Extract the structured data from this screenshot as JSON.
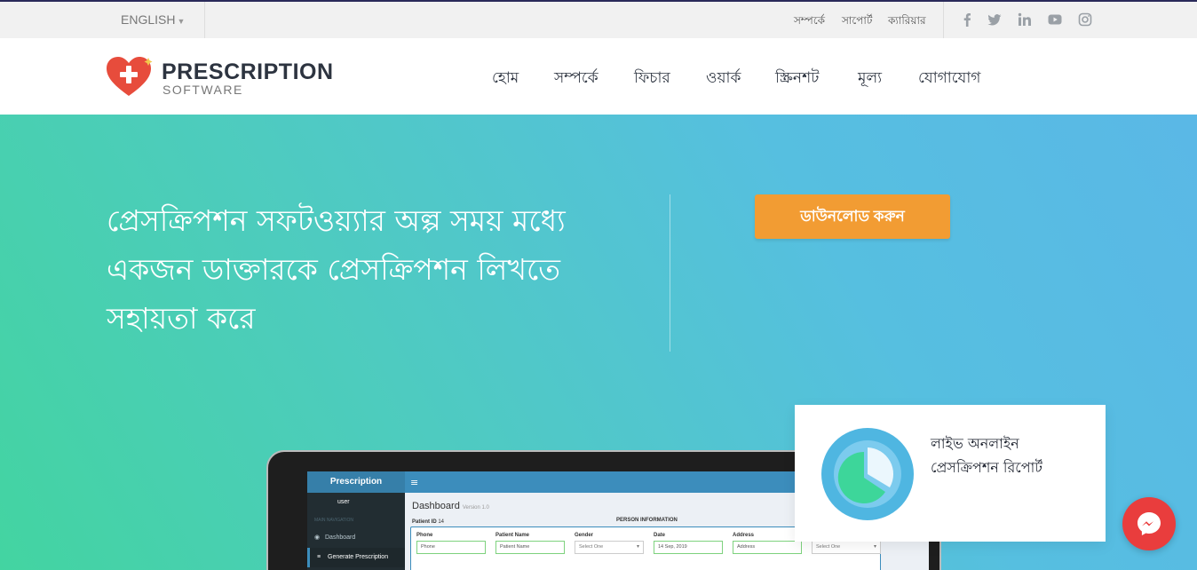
{
  "topbar": {
    "language": "ENGLISH",
    "links": [
      "সম্পর্কে",
      "সাপোর্ট",
      "ক্যারিয়ার"
    ],
    "social_icons": [
      "facebook-icon",
      "twitter-icon",
      "linkedin-icon",
      "youtube-icon",
      "instagram-icon"
    ]
  },
  "header": {
    "logo_title": "PRESCRIPTION",
    "logo_subtitle": "SOFTWARE",
    "nav": [
      "হোম",
      "সম্পর্কে",
      "ফিচার",
      "ওয়ার্ক",
      "স্ক্রিনশট",
      "মূল্য",
      "যোগাযোগ"
    ]
  },
  "hero": {
    "headline_lines": [
      "প্রেসক্রিপশন সফটওয়্যার অল্প সময় মধ্যে",
      "একজন ডাক্তারকে প্রেসক্রিপশন লিখতে",
      "সহায়তা করে"
    ],
    "download_button": "ডাউনলোড করুন"
  },
  "app_preview": {
    "brand": "Prescription",
    "menu_glyph": "≡",
    "user": "user",
    "nav_header": "MAIN NAVIGATION",
    "sidebar_items": [
      "Dashboard",
      "Generate Prescription"
    ],
    "dashboard_title": "Dashboard",
    "version": "Version 1.0",
    "patient_id_label": "Patient ID",
    "patient_id": "14",
    "section_title": "PERSON INFORMATION",
    "fields": [
      {
        "label": "Phone",
        "value": "Phone"
      },
      {
        "label": "Patient Name",
        "value": "Patient Name"
      },
      {
        "label": "Gender",
        "value": "Select One"
      },
      {
        "label": "Date",
        "value": "14 Sep, 2019"
      },
      {
        "label": "Address",
        "value": "Address"
      },
      {
        "label": "",
        "value": "Select One"
      }
    ]
  },
  "report_card": {
    "line1": "লাইভ অনলাইন",
    "line2": "প্রেসক্রিপশন রিপোর্ট"
  },
  "colors": {
    "accent_orange": "#f29c33",
    "hero_gradient_start": "#43d4a1",
    "hero_gradient_end": "#5ab8e6",
    "messenger_red": "#e93d3d",
    "logo_heart": "#e74c3c"
  }
}
